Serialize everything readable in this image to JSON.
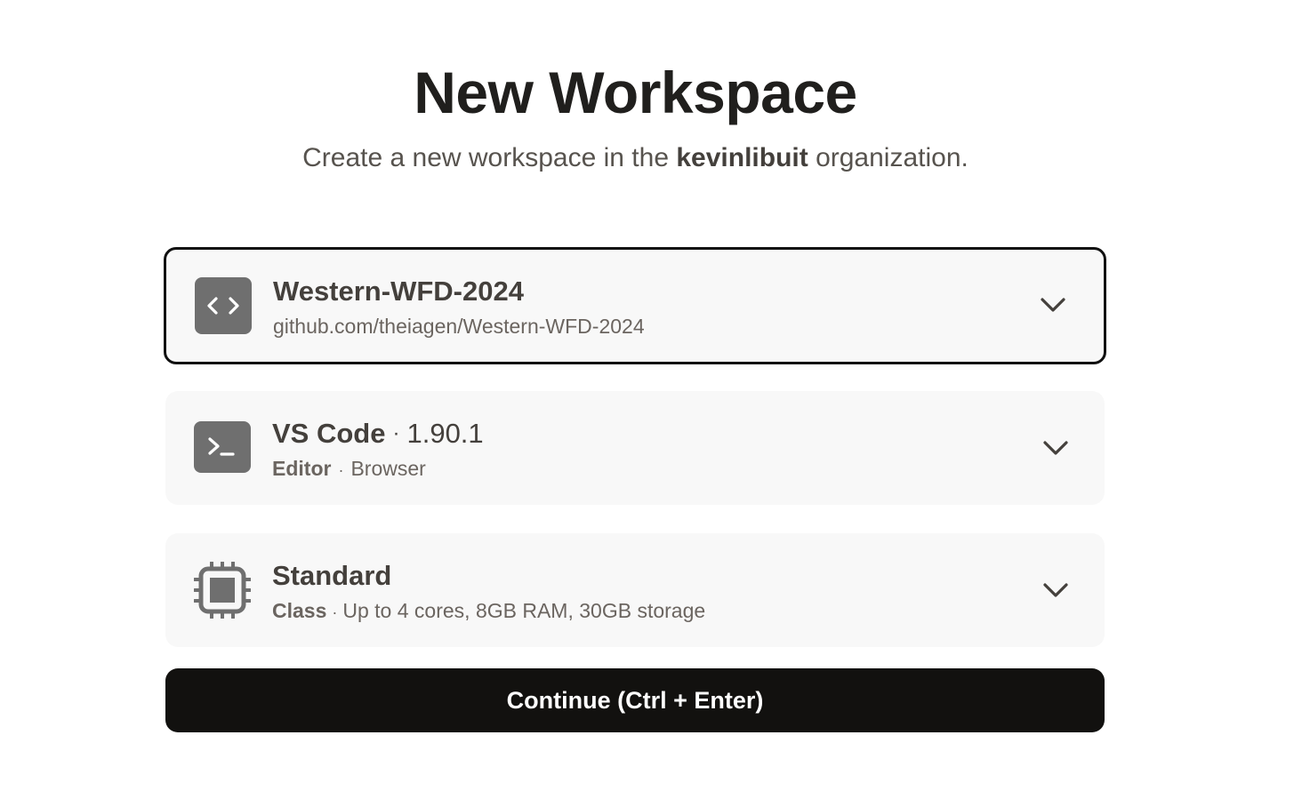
{
  "header": {
    "title": "New Workspace",
    "subtitle_before": "Create a new workspace in the",
    "organization": "kevinlibuit",
    "subtitle_after": "organization."
  },
  "repository": {
    "icon": "code-brackets-icon",
    "name": "Western-WFD-2024",
    "url": "github.com/theiagen/Western-WFD-2024",
    "selected": true
  },
  "editor": {
    "icon": "terminal-icon",
    "name": "VS Code",
    "separator": "·",
    "version": "1.90.1",
    "label": "Editor",
    "type": "Browser"
  },
  "machine_class": {
    "icon": "cpu-chip-icon",
    "name": "Standard",
    "label": "Class",
    "spec": "Up to 4 cores, 8GB RAM, 30GB storage"
  },
  "actions": {
    "continue_label": "Continue (Ctrl + Enter)"
  },
  "colors": {
    "card_background": "#f8f8f8",
    "selected_border": "#111111",
    "primary_button": "#12110f",
    "icon_tile": "#6f6f6f"
  }
}
